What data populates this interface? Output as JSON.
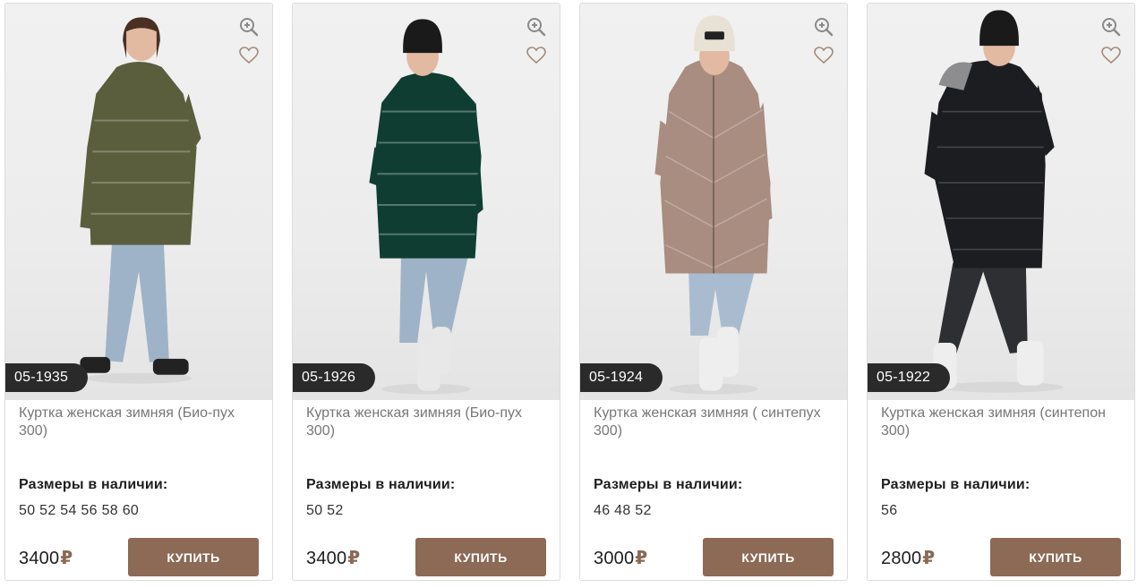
{
  "products": [
    {
      "sku": "05-1935",
      "title": "Куртка женская зимняя (Био-пух 300)",
      "sizes_label": "Размеры в наличии:",
      "sizes": "50 52 54 56 58 60",
      "price": "3400",
      "currency": "₽",
      "buy_label": "КУПИТЬ",
      "coat_color": "#5a5e3c",
      "hat_color": "",
      "pants_color": "#9fb3c8",
      "boots_color": "#222222"
    },
    {
      "sku": "05-1926",
      "title": "Куртка женская зимняя (Био-пух 300)",
      "sizes_label": "Размеры в наличии:",
      "sizes": "50 52",
      "price": "3400",
      "currency": "₽",
      "buy_label": "КУПИТЬ",
      "coat_color": "#0f3d32",
      "hat_color": "#1a1a1a",
      "pants_color": "#9fb3c8",
      "boots_color": "#e8e8e8"
    },
    {
      "sku": "05-1924",
      "title": "Куртка женская зимняя ( синтепух 300)",
      "sizes_label": "Размеры в наличии:",
      "sizes": "46 48 52",
      "price": "3000",
      "currency": "₽",
      "buy_label": "КУПИТЬ",
      "coat_color": "#a88d80",
      "hat_color": "#e8e2d4",
      "pants_color": "#a9bccf",
      "boots_color": "#eeeeee"
    },
    {
      "sku": "05-1922",
      "title": "Куртка женская зимняя (синтепон 300)",
      "sizes_label": "Размеры в наличии:",
      "sizes": "56",
      "price": "2800",
      "currency": "₽",
      "buy_label": "КУПИТЬ",
      "coat_color": "#1c1d21",
      "hat_color": "#1a1a1a",
      "pants_color": "#2e2f33",
      "boots_color": "#eeeeee"
    }
  ],
  "icons": {
    "zoom": "zoom-in-icon",
    "favorite": "heart-icon"
  }
}
